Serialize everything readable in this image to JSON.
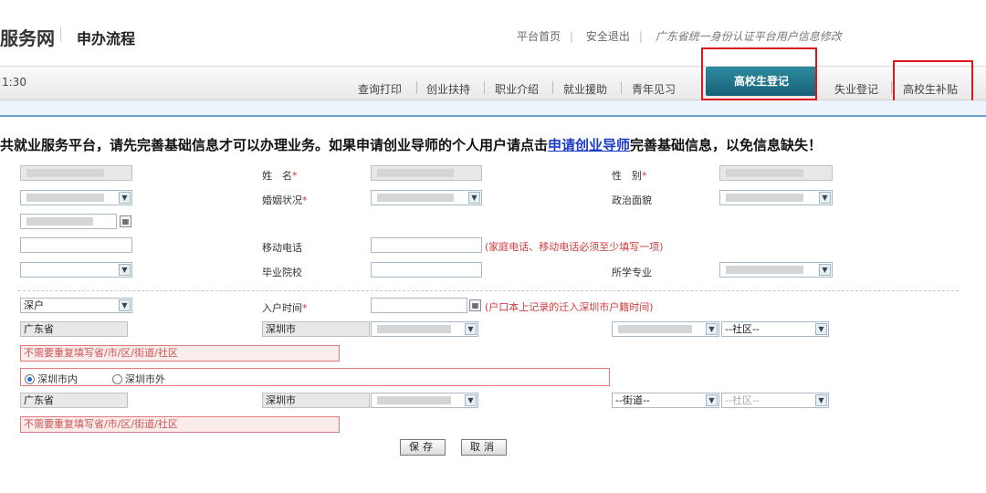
{
  "header": {
    "brand": "服务网",
    "flow_title": "申办流程",
    "links": [
      "平台首页",
      "安全退出",
      "广东省统一身份认证平台用户信息修改"
    ]
  },
  "navbar": {
    "clock": "1:30",
    "items": [
      "查询打印",
      "创业扶持",
      "职业介绍",
      "就业援助",
      "青年见习"
    ],
    "active": "高校生登记",
    "after": [
      "失业登记",
      "高校生补贴"
    ]
  },
  "notice": {
    "before": "共就业服务平台，请先完善基础信息才可以办理业务。如果申请创业导师的个人用户请点击",
    "link": "申请创业导师",
    "after": "完善基础信息，以免信息缺失！"
  },
  "form": {
    "name_label": "姓　名",
    "gender_label": "性　别",
    "marital_label": "婚姻状况",
    "political_label": "政治面貌",
    "mobile_label": "移动电话",
    "phone_hint": "(家庭电话、移动电话必须至少填写一项)",
    "school_label": "毕业院校",
    "major_label": "所学专业",
    "hukou_value": "深户",
    "hukou_time_label": "入户时间",
    "hukou_hint": "(户口本上记录的迁入深圳市户籍时间)",
    "province": "广东省",
    "city": "深圳市",
    "community_placeholder": "--社区--",
    "street_placeholder": "--街道--",
    "address_placeholder": "不需要重复填写省/市/区/街道/社区",
    "radio_in": "深圳市内",
    "radio_out": "深圳市外",
    "required_mark": "*"
  },
  "buttons": {
    "save": "保存",
    "cancel": "取消"
  },
  "colors": {
    "accent": "#17627a",
    "highlight": "#e0161d",
    "link": "#1a3cc9"
  }
}
